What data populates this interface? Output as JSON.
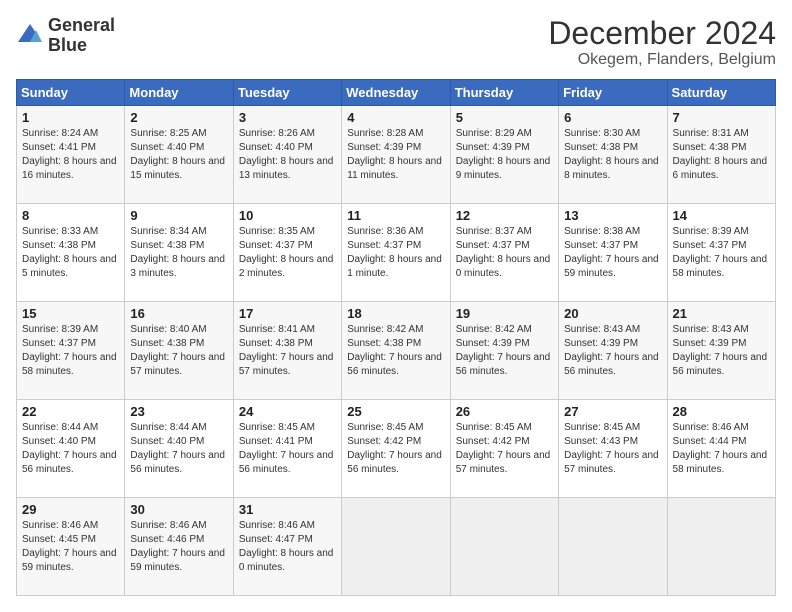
{
  "logo": {
    "line1": "General",
    "line2": "Blue"
  },
  "title": "December 2024",
  "subtitle": "Okegem, Flanders, Belgium",
  "days_of_week": [
    "Sunday",
    "Monday",
    "Tuesday",
    "Wednesday",
    "Thursday",
    "Friday",
    "Saturday"
  ],
  "weeks": [
    [
      {
        "day": "1",
        "info": "Sunrise: 8:24 AM\nSunset: 4:41 PM\nDaylight: 8 hours and 16 minutes."
      },
      {
        "day": "2",
        "info": "Sunrise: 8:25 AM\nSunset: 4:40 PM\nDaylight: 8 hours and 15 minutes."
      },
      {
        "day": "3",
        "info": "Sunrise: 8:26 AM\nSunset: 4:40 PM\nDaylight: 8 hours and 13 minutes."
      },
      {
        "day": "4",
        "info": "Sunrise: 8:28 AM\nSunset: 4:39 PM\nDaylight: 8 hours and 11 minutes."
      },
      {
        "day": "5",
        "info": "Sunrise: 8:29 AM\nSunset: 4:39 PM\nDaylight: 8 hours and 9 minutes."
      },
      {
        "day": "6",
        "info": "Sunrise: 8:30 AM\nSunset: 4:38 PM\nDaylight: 8 hours and 8 minutes."
      },
      {
        "day": "7",
        "info": "Sunrise: 8:31 AM\nSunset: 4:38 PM\nDaylight: 8 hours and 6 minutes."
      }
    ],
    [
      {
        "day": "8",
        "info": "Sunrise: 8:33 AM\nSunset: 4:38 PM\nDaylight: 8 hours and 5 minutes."
      },
      {
        "day": "9",
        "info": "Sunrise: 8:34 AM\nSunset: 4:38 PM\nDaylight: 8 hours and 3 minutes."
      },
      {
        "day": "10",
        "info": "Sunrise: 8:35 AM\nSunset: 4:37 PM\nDaylight: 8 hours and 2 minutes."
      },
      {
        "day": "11",
        "info": "Sunrise: 8:36 AM\nSunset: 4:37 PM\nDaylight: 8 hours and 1 minute."
      },
      {
        "day": "12",
        "info": "Sunrise: 8:37 AM\nSunset: 4:37 PM\nDaylight: 8 hours and 0 minutes."
      },
      {
        "day": "13",
        "info": "Sunrise: 8:38 AM\nSunset: 4:37 PM\nDaylight: 7 hours and 59 minutes."
      },
      {
        "day": "14",
        "info": "Sunrise: 8:39 AM\nSunset: 4:37 PM\nDaylight: 7 hours and 58 minutes."
      }
    ],
    [
      {
        "day": "15",
        "info": "Sunrise: 8:39 AM\nSunset: 4:37 PM\nDaylight: 7 hours and 58 minutes."
      },
      {
        "day": "16",
        "info": "Sunrise: 8:40 AM\nSunset: 4:38 PM\nDaylight: 7 hours and 57 minutes."
      },
      {
        "day": "17",
        "info": "Sunrise: 8:41 AM\nSunset: 4:38 PM\nDaylight: 7 hours and 57 minutes."
      },
      {
        "day": "18",
        "info": "Sunrise: 8:42 AM\nSunset: 4:38 PM\nDaylight: 7 hours and 56 minutes."
      },
      {
        "day": "19",
        "info": "Sunrise: 8:42 AM\nSunset: 4:39 PM\nDaylight: 7 hours and 56 minutes."
      },
      {
        "day": "20",
        "info": "Sunrise: 8:43 AM\nSunset: 4:39 PM\nDaylight: 7 hours and 56 minutes."
      },
      {
        "day": "21",
        "info": "Sunrise: 8:43 AM\nSunset: 4:39 PM\nDaylight: 7 hours and 56 minutes."
      }
    ],
    [
      {
        "day": "22",
        "info": "Sunrise: 8:44 AM\nSunset: 4:40 PM\nDaylight: 7 hours and 56 minutes."
      },
      {
        "day": "23",
        "info": "Sunrise: 8:44 AM\nSunset: 4:40 PM\nDaylight: 7 hours and 56 minutes."
      },
      {
        "day": "24",
        "info": "Sunrise: 8:45 AM\nSunset: 4:41 PM\nDaylight: 7 hours and 56 minutes."
      },
      {
        "day": "25",
        "info": "Sunrise: 8:45 AM\nSunset: 4:42 PM\nDaylight: 7 hours and 56 minutes."
      },
      {
        "day": "26",
        "info": "Sunrise: 8:45 AM\nSunset: 4:42 PM\nDaylight: 7 hours and 57 minutes."
      },
      {
        "day": "27",
        "info": "Sunrise: 8:45 AM\nSunset: 4:43 PM\nDaylight: 7 hours and 57 minutes."
      },
      {
        "day": "28",
        "info": "Sunrise: 8:46 AM\nSunset: 4:44 PM\nDaylight: 7 hours and 58 minutes."
      }
    ],
    [
      {
        "day": "29",
        "info": "Sunrise: 8:46 AM\nSunset: 4:45 PM\nDaylight: 7 hours and 59 minutes."
      },
      {
        "day": "30",
        "info": "Sunrise: 8:46 AM\nSunset: 4:46 PM\nDaylight: 7 hours and 59 minutes."
      },
      {
        "day": "31",
        "info": "Sunrise: 8:46 AM\nSunset: 4:47 PM\nDaylight: 8 hours and 0 minutes."
      },
      {
        "day": "",
        "info": ""
      },
      {
        "day": "",
        "info": ""
      },
      {
        "day": "",
        "info": ""
      },
      {
        "day": "",
        "info": ""
      }
    ]
  ]
}
